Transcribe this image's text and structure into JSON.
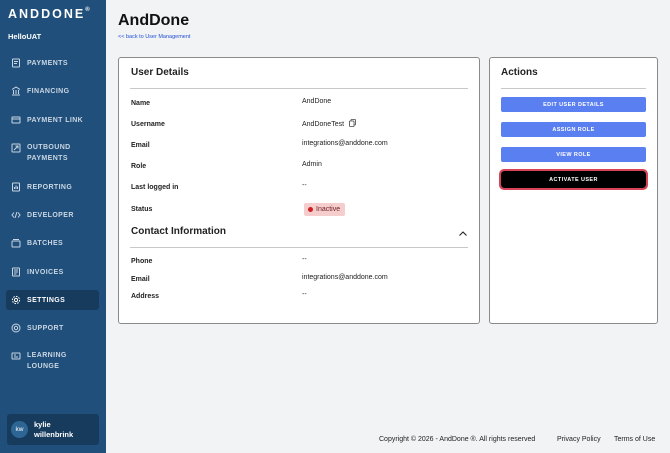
{
  "sidebar": {
    "brand": "ANDDONE",
    "brand_mark": "®",
    "tenant": "HelloUAT",
    "items": [
      {
        "label": "PAYMENTS",
        "icon": "payments-icon"
      },
      {
        "label": "FINANCING",
        "icon": "bank-icon"
      },
      {
        "label": "PAYMENT LINK",
        "icon": "payment-link-icon"
      },
      {
        "label": "OUTBOUND",
        "label2": "PAYMENTS",
        "icon": "outbound-payments-icon"
      },
      {
        "label": "REPORTING",
        "icon": "reporting-icon"
      },
      {
        "label": "DEVELOPER",
        "icon": "code-icon"
      },
      {
        "label": "BATCHES",
        "icon": "batches-icon"
      },
      {
        "label": "INVOICES",
        "icon": "invoices-icon"
      },
      {
        "label": "SETTINGS",
        "icon": "gear-icon",
        "active": true
      },
      {
        "label": "SUPPORT",
        "icon": "support-icon"
      },
      {
        "label": "LEARNING",
        "label2": "LOUNGE",
        "icon": "learning-icon"
      }
    ],
    "user": {
      "initials": "kw",
      "first": "kylie",
      "last": "willenbrink"
    }
  },
  "header": {
    "title": "AndDone",
    "back_link": "<< back to User Management"
  },
  "user_details": {
    "title": "User Details",
    "fields": [
      {
        "label": "Name",
        "value": "AndDone"
      },
      {
        "label": "Username",
        "value": "AndDoneTest"
      },
      {
        "label": "Email",
        "value": "integrations@anddone.com"
      },
      {
        "label": "Role",
        "value": "Admin"
      },
      {
        "label": "Last logged in",
        "value": "--"
      },
      {
        "label": "Status",
        "value": "Inactive"
      }
    ]
  },
  "contact_info": {
    "title": "Contact Information",
    "fields": [
      {
        "label": "Phone",
        "value": "--"
      },
      {
        "label": "Email",
        "value": "integrations@anddone.com"
      },
      {
        "label": "Address",
        "value": "--"
      }
    ]
  },
  "actions": {
    "title": "Actions",
    "buttons": [
      {
        "label": "EDIT USER DETAILS"
      },
      {
        "label": "ASSIGN ROLE"
      },
      {
        "label": "VIEW ROLE"
      },
      {
        "label": "ACTIVATE USER"
      }
    ]
  },
  "footer": {
    "copyright": "Copyright © 2026 - AndDone ®. All rights reserved",
    "privacy": "Privacy Policy",
    "terms": "Terms of Use"
  },
  "colors": {
    "sidebar": "#1f4f7a",
    "sidebar_active": "#173b5d",
    "primary_button": "#5a7ff0",
    "status_inactive_bg": "#f6cdcd",
    "status_inactive_dot": "#d01f1f",
    "focus_ring": "#d9435a"
  }
}
